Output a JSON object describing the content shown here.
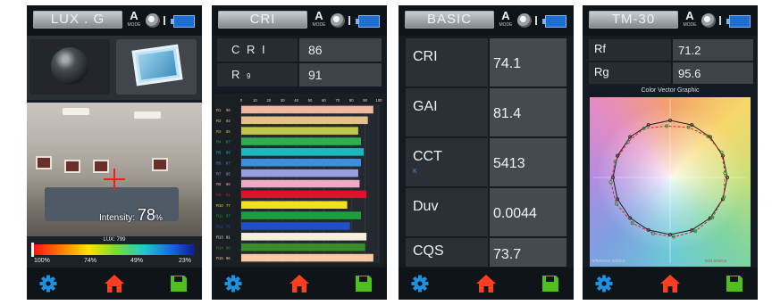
{
  "accent": {
    "icon_blue": "#1e90e0",
    "home_red": "#ff3d1f",
    "save_green": "#4fbf1e",
    "reference": "#222222",
    "test": "#e02020"
  },
  "status": {
    "mode_letter": "A",
    "mode_sub": "MODE"
  },
  "panel1": {
    "title": "LUX . G",
    "intensity_label": "Intensity:",
    "intensity_value": "78",
    "intensity_unit": "%",
    "lux_label": "LUX: 799",
    "scale_marks": [
      "100%",
      "74%",
      "49%",
      "23%"
    ],
    "icons": {
      "mode_a": "lens-icon",
      "mode_b": "photo-icon",
      "nav": [
        "gear-icon",
        "home-icon",
        "save-icon"
      ]
    }
  },
  "panel2": {
    "title": "CRI",
    "rows": [
      {
        "label": "C R I",
        "value": "86"
      },
      {
        "label": "R",
        "label_sub": "9",
        "value": "91"
      }
    ]
  },
  "panel3": {
    "title": "BASIC",
    "rows": [
      {
        "label": "CRI",
        "value": "74.1"
      },
      {
        "label": "GAI",
        "value": "81.4"
      },
      {
        "label": "CCT",
        "sub": "K",
        "value": "5413"
      },
      {
        "label": "Duv",
        "value": "0.0044"
      },
      {
        "label": "CQS",
        "value": "73.7"
      }
    ]
  },
  "panel4": {
    "title": "TM-30",
    "rows": [
      {
        "label": "Rf",
        "value": "71.2"
      },
      {
        "label": "Rg",
        "value": "95.6"
      }
    ],
    "graphic_title": "Color Vector Graphic",
    "legend_reference": "reference source",
    "legend_test": "test source"
  },
  "chart_data": [
    {
      "type": "bar",
      "orientation": "horizontal",
      "xlim": [
        0,
        100
      ],
      "x_ticks": [
        "0",
        "10",
        "20",
        "30",
        "40",
        "50",
        "60",
        "70",
        "80",
        "90",
        "100"
      ],
      "categories": [
        "R1",
        "R2",
        "R3",
        "R4",
        "R5",
        "R6",
        "R7",
        "R8",
        "R9",
        "R10",
        "R11",
        "R12",
        "R13",
        "R14",
        "R15"
      ],
      "values": [
        96,
        92,
        85,
        87,
        89,
        87,
        85,
        86,
        91,
        77,
        87,
        79,
        91,
        90,
        96
      ],
      "colors": [
        "#f0b8a0",
        "#e6c08c",
        "#c2c64a",
        "#2eae4e",
        "#1fb6c0",
        "#3c8fdd",
        "#9a9ee0",
        "#f0a8c4",
        "#e0102a",
        "#f0e020",
        "#1f9e3e",
        "#2050c8",
        "#f8eedc",
        "#3c8c2e",
        "#f8cba6"
      ]
    },
    {
      "type": "line",
      "name": "Color Vector Graphic",
      "series": [
        {
          "name": "reference source",
          "color": "#222222",
          "points": [
            [
              1.0,
              0.0
            ],
            [
              0.92,
              0.38
            ],
            [
              0.7,
              0.71
            ],
            [
              0.38,
              0.92
            ],
            [
              0.0,
              1.0
            ],
            [
              -0.38,
              0.92
            ],
            [
              -0.7,
              0.71
            ],
            [
              -0.92,
              0.38
            ],
            [
              -1.0,
              0.0
            ],
            [
              -0.92,
              -0.38
            ],
            [
              -0.7,
              -0.71
            ],
            [
              -0.38,
              -0.92
            ],
            [
              0.0,
              -1.0
            ],
            [
              0.38,
              -0.92
            ],
            [
              0.7,
              -0.71
            ],
            [
              0.92,
              -0.38
            ],
            [
              1.0,
              0.0
            ]
          ]
        },
        {
          "name": "test source",
          "color": "#e02020",
          "points": [
            [
              0.96,
              0.08
            ],
            [
              0.9,
              0.44
            ],
            [
              0.66,
              0.72
            ],
            [
              0.32,
              0.88
            ],
            [
              -0.06,
              0.9
            ],
            [
              -0.46,
              0.86
            ],
            [
              -0.74,
              0.62
            ],
            [
              -0.96,
              0.28
            ],
            [
              -1.04,
              -0.08
            ],
            [
              -0.94,
              -0.46
            ],
            [
              -0.66,
              -0.8
            ],
            [
              -0.3,
              -0.98
            ],
            [
              0.06,
              -1.04
            ],
            [
              0.44,
              -0.94
            ],
            [
              0.74,
              -0.7
            ],
            [
              0.94,
              -0.34
            ],
            [
              0.96,
              0.08
            ]
          ]
        }
      ]
    }
  ]
}
